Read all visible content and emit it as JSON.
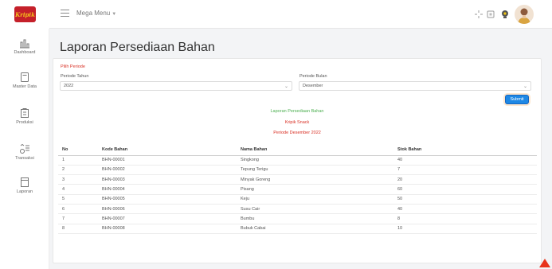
{
  "header": {
    "logo_text": "Kripik",
    "mega_menu_label": "Mega Menu",
    "icons": [
      "expand-icon",
      "fullscreen-icon",
      "notification-icon",
      "user-avatar"
    ]
  },
  "sidebar": {
    "items": [
      {
        "label": "Dashboard",
        "icon": "chart-icon"
      },
      {
        "label": "Master Data",
        "icon": "document-icon"
      },
      {
        "label": "Produksi",
        "icon": "factory-icon"
      },
      {
        "label": "Transaksi",
        "icon": "transaction-icon"
      },
      {
        "label": "Laporan",
        "icon": "report-icon"
      }
    ]
  },
  "page": {
    "title": "Laporan Persediaan Bahan"
  },
  "filter": {
    "section_label": "Pilih Periode",
    "year_label": "Periode Tahun",
    "year_value": "2022",
    "month_label": "Periode Bulan",
    "month_value": "Desember",
    "submit_label": "Submit"
  },
  "report": {
    "title": "Laporan Persediaan Bahan",
    "subtitle": "Kripik Snack",
    "period": "Periode Desember 2022"
  },
  "table": {
    "headers": [
      "No",
      "Kode Bahan",
      "Nama Bahan",
      "Stok Bahan"
    ],
    "rows": [
      [
        "1",
        "BHN-00001",
        "Singkong",
        "40"
      ],
      [
        "2",
        "BHN-00002",
        "Tepung Terigu",
        "7"
      ],
      [
        "3",
        "BHN-00003",
        "Minyak Goreng",
        "20"
      ],
      [
        "4",
        "BHN-00004",
        "Pisang",
        "60"
      ],
      [
        "5",
        "BHN-00005",
        "Keju",
        "50"
      ],
      [
        "6",
        "BHN-00006",
        "Susu Cair",
        "40"
      ],
      [
        "7",
        "BHN-00007",
        "Bumbu",
        "8"
      ],
      [
        "8",
        "BHN-00008",
        "Bubuk Cabai",
        "10"
      ]
    ]
  },
  "colors": {
    "accent": "#1e88e5",
    "danger": "#d93025",
    "success": "#4caf50",
    "logo": "#c5202a"
  }
}
